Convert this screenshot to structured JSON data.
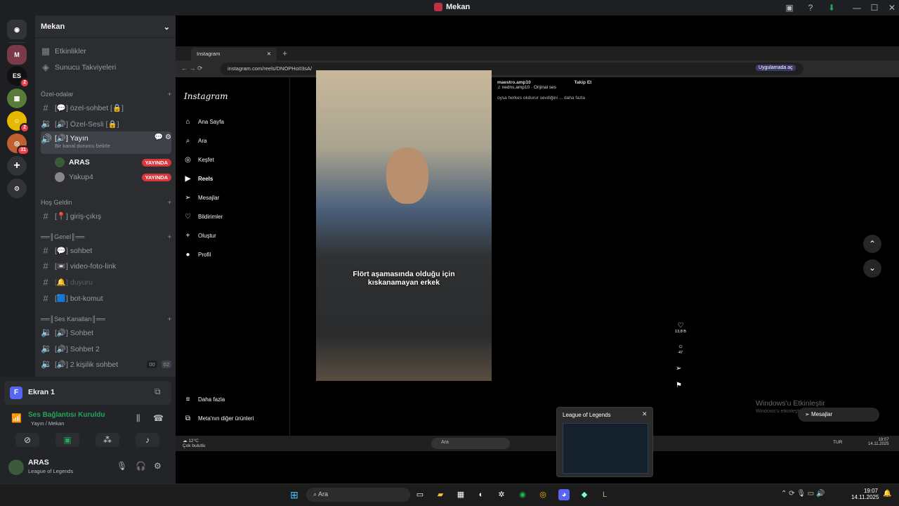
{
  "window": {
    "title": "Mekan"
  },
  "server": {
    "name": "Mekan"
  },
  "rail": {
    "badges": [
      "2",
      "2",
      "2",
      "31"
    ]
  },
  "menu": {
    "events": "Etkinlikler",
    "boosts": "Sunucu Takviyeleri"
  },
  "categories": {
    "private": "Özel-odalar",
    "welcome": "Hoş Geldin",
    "general": "══║Genel║══",
    "voice": "══║Ses Kanalları║══"
  },
  "channels": {
    "private_chat": "[💬] özel-sohbet [🔒]",
    "private_voice": "[🔊] Özel-Sesli [🔒]",
    "stream": "[🔊] Yayın",
    "stream_status": "Bir kanal durumu belirle",
    "entry": "[📍] giriş-çıkış",
    "sohbet": "[💬] sohbet",
    "video": "[📼] video-foto-link",
    "duyuru": "[🔔] duyuru",
    "bot": "[🟦] bot-komut",
    "v_sohbet": "[🔊] Sohbet",
    "v_sohbet2": "[🔊] Sohbet 2",
    "v_duo": "[🔊] 2 kişilik sohbet",
    "duo_a": "00",
    "duo_b": "02"
  },
  "voice_users": [
    {
      "name": "ARAS",
      "badge": "YAYINDA"
    },
    {
      "name": "Yakup4",
      "badge": "YAYINDA"
    }
  ],
  "stream_card": {
    "title": "Ekran 1",
    "avatar": "F"
  },
  "voice_conn": {
    "status": "Ses Bağlantısı Kuruldu",
    "channel": "Yayın / Mekan"
  },
  "user": {
    "name": "ARAS",
    "activity": "League of Legends"
  },
  "browser": {
    "tab": "Instagram",
    "url": "instagram.com/reels/DNOPHoII3sA/",
    "app_btn": "Uygulamada aç"
  },
  "instagram": {
    "logo": "Instagram",
    "nav": [
      "Ana Sayfa",
      "Ara",
      "Keşfet",
      "Reels",
      "Mesajlar",
      "Bildirimler",
      "Oluştur",
      "Profil"
    ],
    "more": "Daha fazla",
    "meta": "Meta'nın diğer ürünleri",
    "post_user": "maestro.amp10",
    "post_audio": "♫ nedns.amp10 · Orijinal ses",
    "follow": "Takip Et",
    "post_caption": "oysa herkes okdurur sevdiğini ... daha fazla",
    "subtitle": "Flört aşamasında olduğu için\nkıskanamayan erkek",
    "likes": "13,8 B",
    "comments": "47",
    "messages": "Mesajlar"
  },
  "activation": {
    "title": "Windows'u Etkinleştir",
    "sub": "Windows'u etkinleştirmek için Ayarlar'a gidin."
  },
  "popup": {
    "title": "League of Legends"
  },
  "inner_taskbar": {
    "temp": "12°C",
    "weather": "Çok bulutlu",
    "search": "Ara",
    "lang": "TUR",
    "time": "19:07",
    "date": "14.11.2025"
  },
  "taskbar": {
    "search": "Ara",
    "time": "19:07",
    "date": "14.11.2025"
  }
}
